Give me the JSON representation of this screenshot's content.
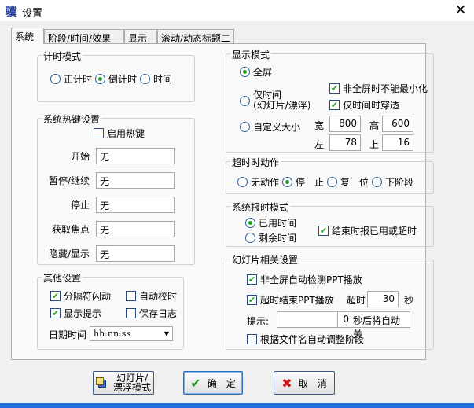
{
  "window": {
    "title": "设置",
    "app_icon": "骥",
    "close": "✕"
  },
  "tabs": [
    "系统",
    "阶段/时间/效果",
    "显示",
    "滚动/动态标题二"
  ],
  "timer_mode": {
    "caption": "计时模式",
    "options": [
      "正计时",
      "倒计时",
      "时间"
    ],
    "selected": 1
  },
  "hotkeys": {
    "caption": "系统热键设置",
    "enable_label": "启用热键",
    "enabled": false,
    "rows": [
      {
        "label": "开始",
        "value": "无"
      },
      {
        "label": "暂停/继续",
        "value": "无"
      },
      {
        "label": "停止",
        "value": "无"
      },
      {
        "label": "获取焦点",
        "value": "无"
      },
      {
        "label": "隐藏/显示",
        "value": "无"
      }
    ]
  },
  "other": {
    "caption": "其他设置",
    "blink": "分隔符闪动",
    "auto_sync": "自动校时",
    "show_tip": "显示提示",
    "save_log": "保存日志",
    "datetime_label": "日期时间",
    "datetime_value": "hh:nn:ss"
  },
  "display_mode": {
    "caption": "显示模式",
    "fullscreen": "全屏",
    "time_only": "仅时间",
    "time_only_sub": "(幻灯片/漂浮)",
    "custom": "自定义大小",
    "no_minimize": "非全屏时不能最小化",
    "passthrough": "仅时间时穿透",
    "width_label": "宽",
    "width": "800",
    "height_label": "高",
    "height": "600",
    "left_label": "左",
    "left": "78",
    "top_label": "上",
    "top": "16"
  },
  "timeout_action": {
    "caption": "超时时动作",
    "options": [
      "无动作",
      "停　止",
      "复　位",
      "下阶段"
    ],
    "selected": 1
  },
  "report_mode": {
    "caption": "系统报时模式",
    "options": [
      "已用时间",
      "剩余时间"
    ],
    "selected": 0,
    "end_report": "结束时报已用或超时"
  },
  "slides": {
    "caption": "幻灯片相关设置",
    "auto_detect": "非全屏自动检测PPT播放",
    "timeout_end": "超时结束PPT播放",
    "timeout_label": "超时",
    "timeout_value": "30",
    "seconds": "秒",
    "tip_label": "提示:",
    "tip_value": "",
    "tip_secs": "0",
    "tip_suffix": "秒后将自动关",
    "auto_stage": "根据文件名自动调整阶段"
  },
  "buttons": {
    "slide_mode": "幻灯片/\n漂浮模式",
    "ok": "确　定",
    "cancel": "取　消"
  }
}
